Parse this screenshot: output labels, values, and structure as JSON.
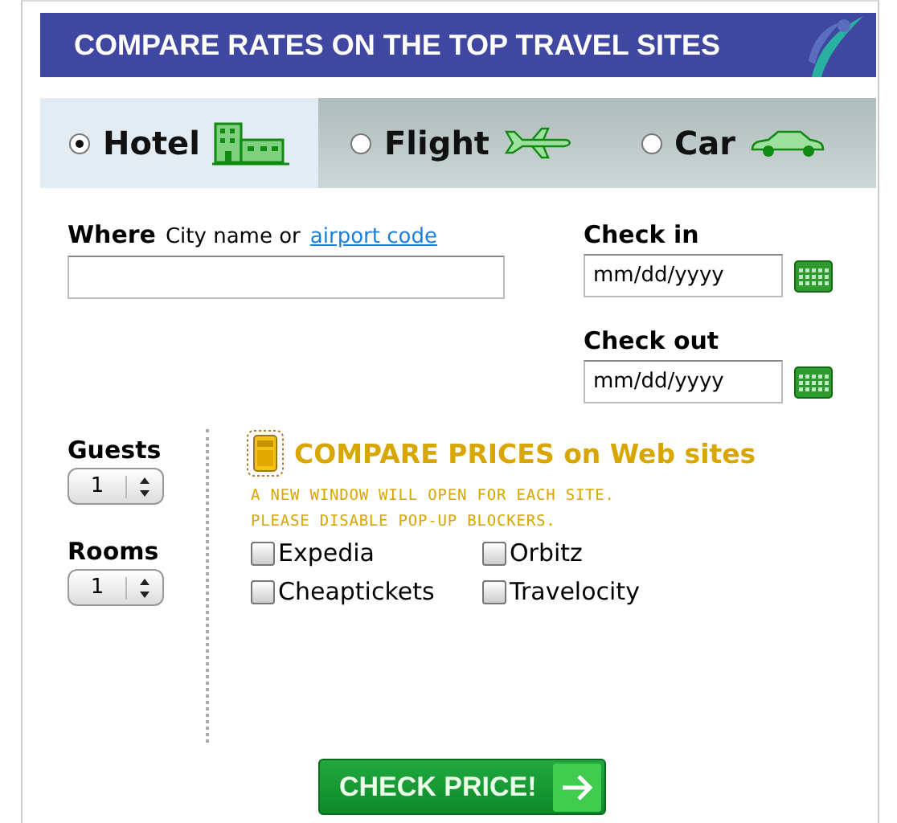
{
  "banner": {
    "title": "COMPARE RATES ON THE TOP TRAVEL SITES"
  },
  "tabs": [
    {
      "label": "Hotel",
      "kind": "hotel",
      "selected": true
    },
    {
      "label": "Flight",
      "kind": "flight",
      "selected": false
    },
    {
      "label": "Car",
      "kind": "car",
      "selected": false
    }
  ],
  "where": {
    "label": "Where",
    "hint": "City name or",
    "link": "airport code"
  },
  "check_in": {
    "label": "Check in",
    "value": "mm/dd/yyyy"
  },
  "check_out": {
    "label": "Check out",
    "value": "mm/dd/yyyy"
  },
  "guests": {
    "label": "Guests",
    "value": "1"
  },
  "rooms": {
    "label": "Rooms",
    "value": "1"
  },
  "compare": {
    "title": "COMPARE PRICES on Web sites",
    "note": [
      "A NEW WINDOW WILL OPEN FOR EACH SITE.",
      "PLEASE DISABLE POP-UP BLOCKERS."
    ]
  },
  "sites": [
    {
      "label": "Expedia",
      "checked": false
    },
    {
      "label": "Orbitz",
      "checked": false
    },
    {
      "label": "Cheaptickets",
      "checked": false
    },
    {
      "label": "Travelocity",
      "checked": false
    }
  ],
  "submit": {
    "label": "CHECK PRICE!"
  }
}
